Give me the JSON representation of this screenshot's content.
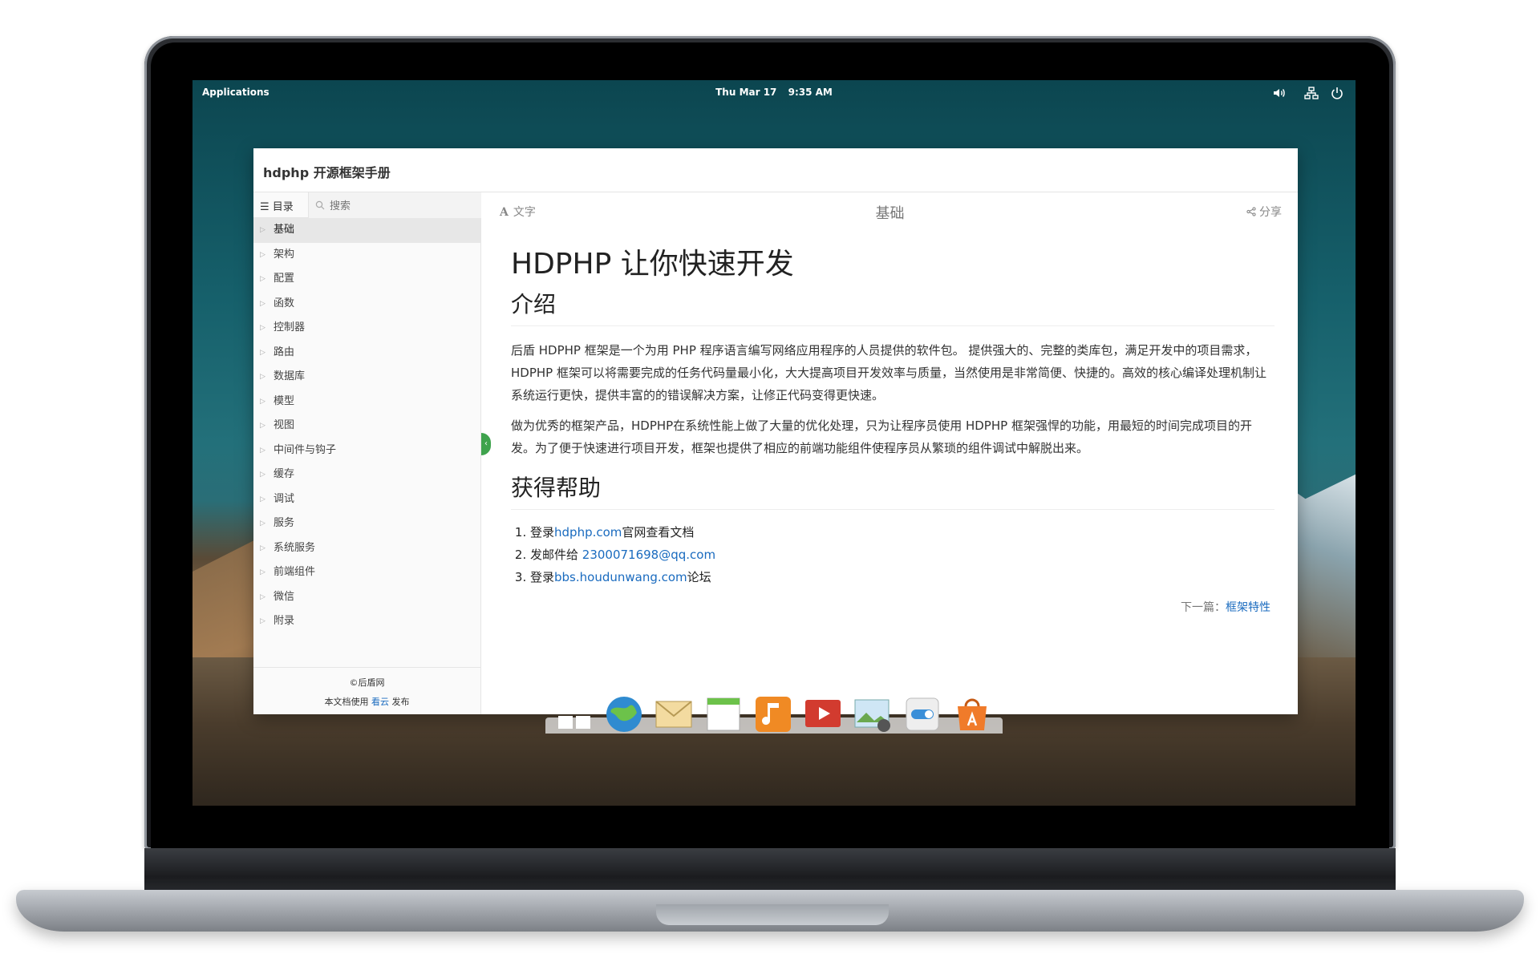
{
  "top_panel": {
    "applications_label": "Applications",
    "date": "Thu Mar 17",
    "time": "9:35 AM",
    "indicators": [
      "volume-icon",
      "network-icon",
      "power-icon"
    ]
  },
  "window": {
    "title": "hdphp 开源框架手册"
  },
  "sidebar": {
    "tab_toc_label": "目录",
    "search_placeholder": "搜索",
    "items": [
      {
        "label": "基础",
        "active": true
      },
      {
        "label": "架构"
      },
      {
        "label": "配置"
      },
      {
        "label": "函数"
      },
      {
        "label": "控制器"
      },
      {
        "label": "路由"
      },
      {
        "label": "数据库"
      },
      {
        "label": "模型"
      },
      {
        "label": "视图"
      },
      {
        "label": "中间件与钩子"
      },
      {
        "label": "缓存"
      },
      {
        "label": "调试"
      },
      {
        "label": "服务"
      },
      {
        "label": "系统服务"
      },
      {
        "label": "前端组件"
      },
      {
        "label": "微信"
      },
      {
        "label": "附录"
      }
    ],
    "footer": {
      "copyright": "©后盾网",
      "published_prefix": "本文档使用",
      "published_link": "看云",
      "published_suffix": "发布"
    }
  },
  "toolbar": {
    "font_label": "文字",
    "chapter_title": "基础",
    "share_label": "分享"
  },
  "article": {
    "h1": "HDPHP 让你快速开发",
    "intro_heading": "介绍",
    "intro_p1": "后盾 HDPHP 框架是一个为用 PHP 程序语言编写网络应用程序的人员提供的软件包。 提供强大的、完整的类库包，满足开发中的项目需求，HDPHP 框架可以将需要完成的任务代码量最小化，大大提高项目开发效率与质量，当然使用是非常简便、快捷的。高效的核心编译处理机制让系统运行更快，提供丰富的的错误解决方案，让修正代码变得更快速。",
    "intro_p2": "做为优秀的框架产品，HDPHP在系统性能上做了大量的优化处理，只为让程序员使用 HDPHP 框架强悍的功能，用最短的时间完成项目的开发。为了便于快速进行项目开发，框架也提供了相应的前端功能组件使程序员从繁琐的组件调试中解脱出来。",
    "help_heading": "获得帮助",
    "help_items": [
      {
        "prefix": "登录",
        "link": "hdphp.com",
        "suffix": "官网查看文档"
      },
      {
        "prefix": "发邮件给 ",
        "link": "2300071698@qq.com",
        "suffix": ""
      },
      {
        "prefix": "登录",
        "link": "bbs.houdunwang.com",
        "suffix": "论坛"
      }
    ],
    "next_prefix": "下一篇：",
    "next_link": "框架特性"
  },
  "dock": {
    "items": [
      {
        "name": "multitasking-view-icon",
        "color": "#3a8fd8"
      },
      {
        "name": "web-browser-icon",
        "color": "#2f8bd0"
      },
      {
        "name": "mail-icon",
        "color": "#e9c77b"
      },
      {
        "name": "calendar-icon",
        "color": "#d9d9d9"
      },
      {
        "name": "music-icon",
        "color": "#f08a24"
      },
      {
        "name": "videos-icon",
        "color": "#d23b2f"
      },
      {
        "name": "photos-icon",
        "color": "#5aa8e0"
      },
      {
        "name": "system-settings-icon",
        "color": "#e8e8e8"
      },
      {
        "name": "appcenter-icon",
        "color": "#f07b2a"
      }
    ]
  }
}
